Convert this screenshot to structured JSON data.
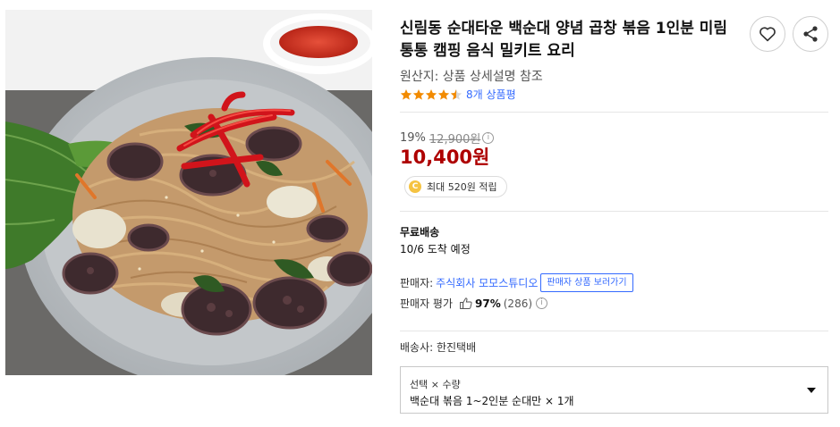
{
  "product": {
    "title": "신림동 순대타운 백순대 양념 곱창 볶음 1인분 미림통통 캠핑 음식 밀키트 요리",
    "origin": "원산지: 상품 상세설명 참조",
    "rating_stars": 4.5,
    "review_text": "8개 상품평"
  },
  "actions": {
    "wishlist_icon": "heart-icon",
    "share_icon": "share-icon"
  },
  "price": {
    "discount_rate": "19%",
    "original_price": "12,900원",
    "info_icon": "i",
    "sale_price": "10,400원",
    "reward_icon": "C",
    "reward_text": "최대 520원 적립"
  },
  "shipping": {
    "label": "무료배송",
    "eta": "10/6 도착 예정"
  },
  "seller": {
    "label": "판매자:",
    "name": "주식회사 모모스튜디오",
    "products_button": "판매자 상품 보러가기",
    "rating_label": "판매자 평가",
    "rating_percent": "97%",
    "rating_count": "(286)"
  },
  "carrier": "배송사: 한진택배",
  "option": {
    "header": "선택 × 수량",
    "value": "백순대 볶음 1~2인분 순대만 × 1개"
  },
  "colors": {
    "accent_blue": "#346aff",
    "sale_red": "#ae0000",
    "star_orange": "#f28b00"
  }
}
